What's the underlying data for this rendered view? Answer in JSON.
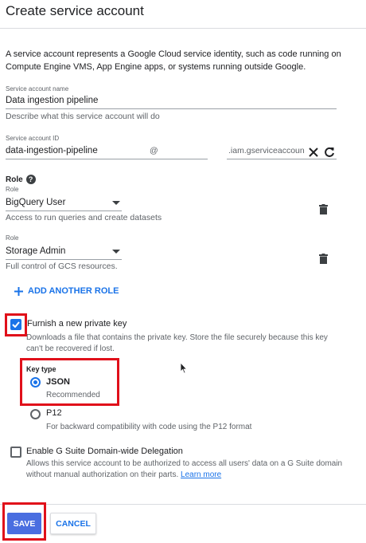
{
  "dialog": {
    "title": "Create service account",
    "description": "A service account represents a Google Cloud service identity, such as code running on Compute Engine VMS, App Engine apps, or systems running outside Google."
  },
  "service_account_name": {
    "label": "Service account name",
    "value": "Data ingestion pipeline",
    "hint": "Describe what this service account will do"
  },
  "service_account_id": {
    "label": "Service account ID",
    "value": "data-ingestion-pipeline",
    "at_symbol": "@",
    "domain": ".iam.gserviceaccoun"
  },
  "roles": {
    "heading": "Role",
    "items": [
      {
        "label": "Role",
        "value": "BigQuery User",
        "description": "Access to run queries and create datasets"
      },
      {
        "label": "Role",
        "value": "Storage Admin",
        "description": "Full control of GCS resources."
      }
    ],
    "add_label": "ADD ANOTHER ROLE"
  },
  "private_key": {
    "checked": true,
    "label": "Furnish a new private key",
    "description": "Downloads a file that contains the private key. Store the file securely because this key can't be recovered if lost.",
    "key_type_label": "Key type",
    "options": [
      {
        "label": "JSON",
        "sub": "Recommended",
        "selected": true
      },
      {
        "label": "P12",
        "sub": "For backward compatibility with code using the P12 format",
        "selected": false
      }
    ]
  },
  "delegation": {
    "checked": false,
    "label": "Enable G Suite Domain-wide Delegation",
    "description": "Allows this service account to be authorized to access all users' data on a G Suite domain without manual authorization on their parts.",
    "link": "Learn more"
  },
  "actions": {
    "save": "SAVE",
    "cancel": "CANCEL"
  },
  "colors": {
    "accent": "#1a73e8",
    "highlight": "#e0101a",
    "save_button": "#4a6ee0"
  }
}
